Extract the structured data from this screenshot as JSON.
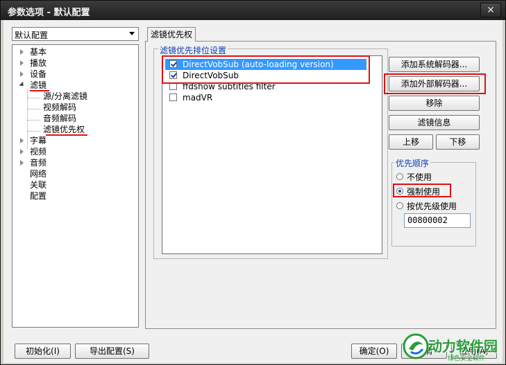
{
  "window": {
    "title": "参数选项 - 默认配置",
    "close_glyph": "✕"
  },
  "profile_combo": {
    "value": "默认配置"
  },
  "tree": {
    "items": [
      {
        "label": "基本",
        "level": 0,
        "expander": "closed"
      },
      {
        "label": "播放",
        "level": 0,
        "expander": "closed"
      },
      {
        "label": "设备",
        "level": 0,
        "expander": "closed"
      },
      {
        "label": "滤镜",
        "level": 0,
        "expander": "open",
        "highlighted": true
      },
      {
        "label": "源/分离滤镜",
        "level": 1
      },
      {
        "label": "视频解码",
        "level": 1
      },
      {
        "label": "音频解码",
        "level": 1
      },
      {
        "label": "滤镜优先权",
        "level": 1,
        "highlighted": true
      },
      {
        "label": "字幕",
        "level": 0,
        "expander": "closed"
      },
      {
        "label": "视频",
        "level": 0,
        "expander": "closed"
      },
      {
        "label": "音频",
        "level": 0,
        "expander": "closed"
      },
      {
        "label": "网络",
        "level": 0
      },
      {
        "label": "关联",
        "level": 0
      },
      {
        "label": "配置",
        "level": 0
      }
    ]
  },
  "tab": {
    "label": "滤镜优先权"
  },
  "filter_group": {
    "label": "滤镜优先排位设置"
  },
  "filters": [
    {
      "label": "DirectVobSub (auto-loading version)",
      "checked": true,
      "selected": true
    },
    {
      "label": "DirectVobSub",
      "checked": true,
      "selected": false
    },
    {
      "label": "ffdshow subtitles filter",
      "checked": false,
      "selected": false
    },
    {
      "label": "madVR",
      "checked": false,
      "selected": false
    }
  ],
  "buttons": {
    "add_system": "添加系统解码器...",
    "add_external": "添加外部解码器...",
    "remove": "移除",
    "filter_info": "滤镜信息",
    "move_up": "上移",
    "move_down": "下移",
    "init": "初始化(I)",
    "export": "导出配置(S)",
    "ok": "确定(O)",
    "cancel": "取消",
    "apply": "应用(A)"
  },
  "priority": {
    "label": "优先顺序",
    "options": [
      {
        "label": "不使用",
        "checked": false
      },
      {
        "label": "强制使用",
        "checked": true
      },
      {
        "label": "按优先级使用",
        "checked": false
      }
    ],
    "value": "00800002"
  },
  "watermark": {
    "text": "动力软件园",
    "subtext": "绿色安全软件"
  },
  "colors": {
    "highlight_red": "#e01010",
    "selection_blue": "#3399ff",
    "group_label_blue": "#0b3fb0"
  }
}
